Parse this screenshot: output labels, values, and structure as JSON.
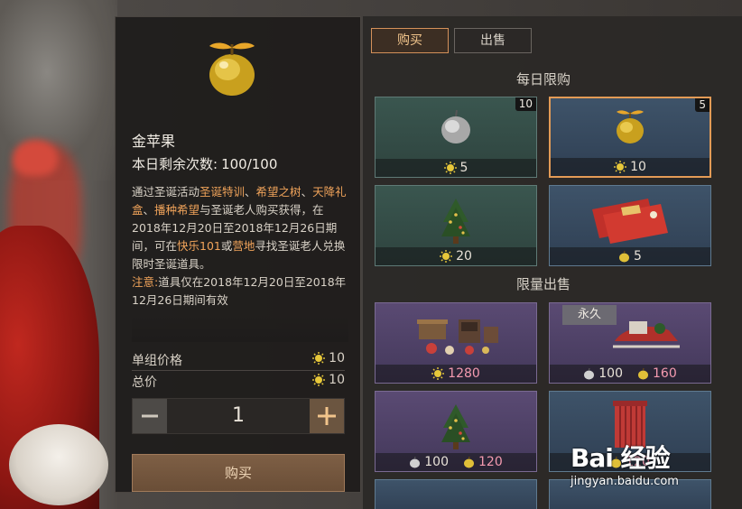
{
  "detail": {
    "item_name": "金苹果",
    "remaining_label": "本日剩余次数:",
    "remaining_value": "100/100",
    "desc": {
      "p1_a": "通过圣诞活动",
      "p1_h1": "圣诞特训",
      "p1_s1": "、",
      "p1_h2": "希望之树",
      "p1_s2": "、",
      "p1_h3": "天降礼盒",
      "p1_s3": "、",
      "p1_h4": "播种希望",
      "p1_b": "与圣诞老人购买获得，在2018年12月20日至2018年12月26日期间，可在",
      "p1_h5": "快乐101",
      "p1_c": "或",
      "p1_h6": "营地",
      "p1_d": "寻找圣诞老人兑换限时圣诞道具。",
      "p2_note": "注意:",
      "p2_text": "道具仅在2018年12月20日至2018年12月26日期间有效"
    },
    "unit_price_label": "单组价格",
    "unit_price_value": "10",
    "total_label": "总价",
    "total_value": "10",
    "quantity": "1",
    "buy_label": "购买"
  },
  "tabs": [
    {
      "label": "购买",
      "active": true
    },
    {
      "label": "出售",
      "active": false
    }
  ],
  "sections": {
    "daily": "每日限购",
    "limited": "限量出售"
  },
  "cards": {
    "silver_apple": {
      "badge": "10",
      "price": "5"
    },
    "gold_apple": {
      "badge": "5",
      "price": "10"
    },
    "tree": {
      "price": "20"
    },
    "cards_item": {
      "price": "5"
    },
    "furniture": {
      "price": "1280"
    },
    "sleigh": {
      "tag": "永久",
      "price_a": "100",
      "price_b": "160"
    },
    "tree2": {
      "price_a": "100",
      "price_b": "120"
    },
    "curtain": {
      "price": "120"
    }
  },
  "watermark": {
    "logo": "Bai 经验",
    "url": "jingyan.baidu.com"
  },
  "colors": {
    "accent": "#e39b56",
    "highlight_text": "#f0a35a",
    "pink_price": "#f49ab0"
  },
  "icons": [
    "golden-apple-icon",
    "silver-apple-icon",
    "sun-coin-icon",
    "apple-coin-icon",
    "gold-apple-coin-icon",
    "minus-icon",
    "plus-icon"
  ]
}
